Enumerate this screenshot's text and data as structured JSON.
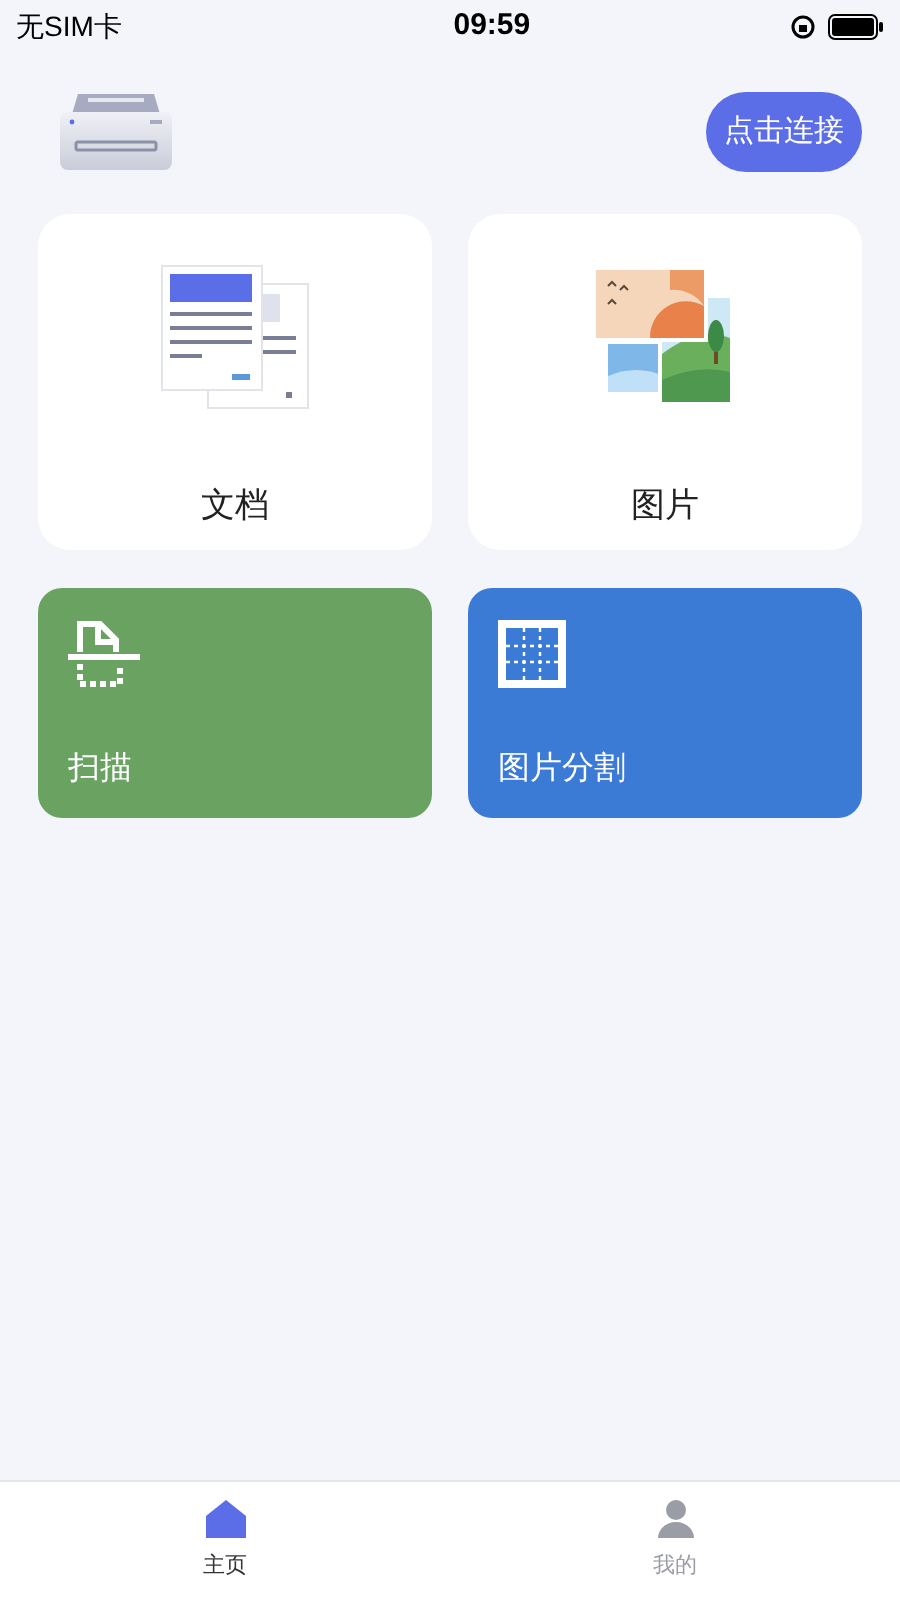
{
  "status_bar": {
    "carrier": "无SIM卡",
    "time": "09:59"
  },
  "connect_button": "点击连接",
  "cards": [
    {
      "kind": "document",
      "label": "文档"
    },
    {
      "kind": "photo",
      "label": "图片"
    },
    {
      "kind": "scan",
      "label": "扫描",
      "color": "#6aa262"
    },
    {
      "kind": "split",
      "label": "图片分割",
      "color": "#3b7bd6"
    }
  ],
  "tabs": [
    {
      "kind": "home",
      "label": "主页",
      "selected": true
    },
    {
      "kind": "me",
      "label": "我的",
      "selected": false
    }
  ]
}
